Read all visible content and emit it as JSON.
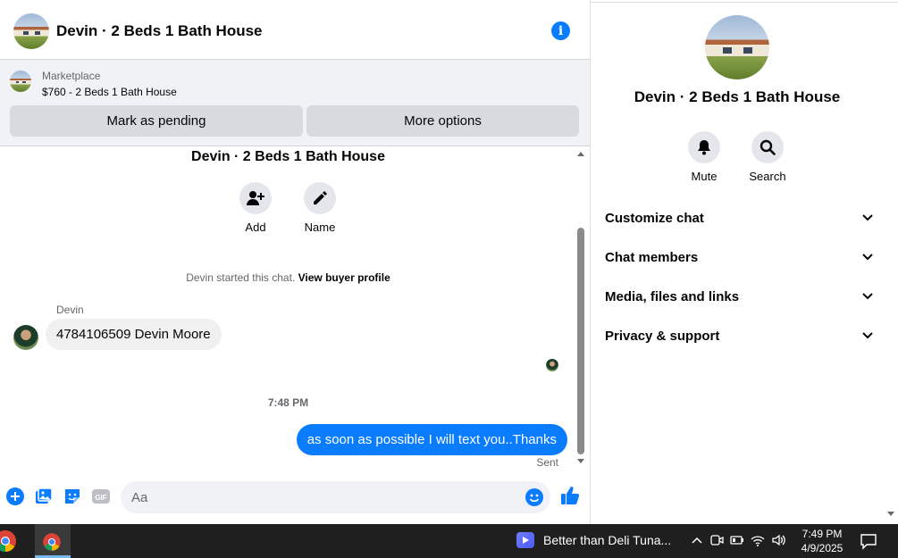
{
  "colors": {
    "accent": "#0a7cff",
    "bubble_in": "#f0f0f0",
    "panel_gray": "#f0f2f5",
    "button_gray": "#d8dadf",
    "taskbar": "#1f1f1f"
  },
  "header": {
    "title": "Devin · 2 Beds 1 Bath House",
    "info_icon": "info-icon"
  },
  "listing": {
    "label": "Marketplace",
    "price_title": "$760 - 2 Beds 1 Bath House",
    "mark_pending": "Mark as pending",
    "more_options": "More options"
  },
  "thread": {
    "title": "Devin · 2 Beds 1 Bath House",
    "actions": [
      {
        "label": "Add",
        "icon": "add-person-icon"
      },
      {
        "label": "Name",
        "icon": "pencil-icon"
      }
    ],
    "started_text": "Devin started this chat.",
    "view_profile": "View buyer profile",
    "messages": [
      {
        "sender": "Devin",
        "text": "4784106509 Devin Moore",
        "direction": "incoming"
      },
      {
        "timestamp": "7:48 PM"
      },
      {
        "text": "as soon as possible I will text you..Thanks",
        "direction": "outgoing",
        "status": "Sent"
      }
    ]
  },
  "composer": {
    "placeholder": "Aa",
    "value": "",
    "icons": [
      "plus-icon",
      "photo-icon",
      "sticker-icon",
      "gif-icon",
      "emoji-icon",
      "thumbs-up-icon"
    ],
    "gif_text": "GIF"
  },
  "details": {
    "title": "Devin · 2 Beds 1 Bath House",
    "actions": [
      {
        "label": "Mute",
        "icon": "bell-icon"
      },
      {
        "label": "Search",
        "icon": "search-icon"
      }
    ],
    "sections": [
      {
        "label": "Customize chat"
      },
      {
        "label": "Chat members"
      },
      {
        "label": "Media, files and links"
      },
      {
        "label": "Privacy & support"
      }
    ]
  },
  "taskbar": {
    "media_title": "Better than Deli Tuna...",
    "time": "7:49 PM",
    "date": "4/9/2025"
  }
}
